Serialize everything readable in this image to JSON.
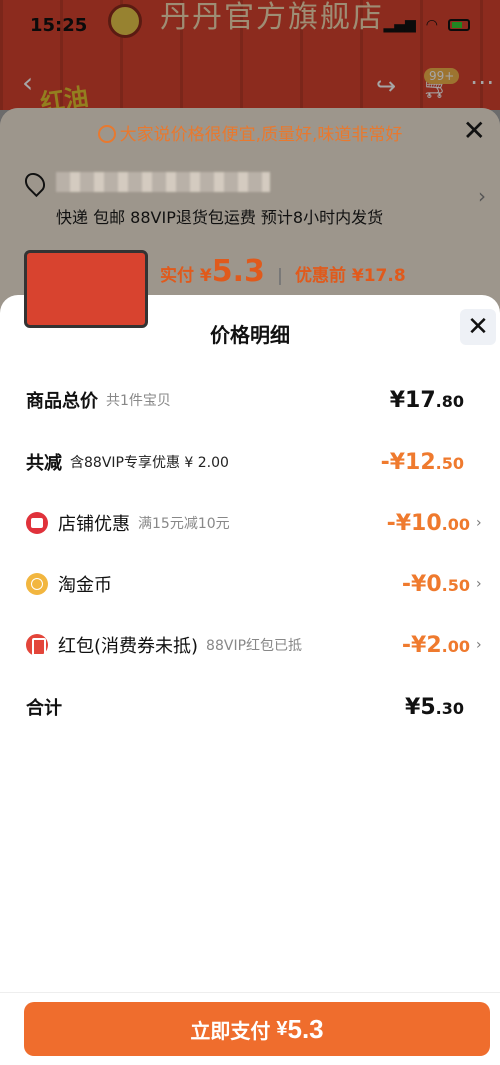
{
  "status_bar": {
    "time": "15:25"
  },
  "store": {
    "title": "丹丹官方旗舰店",
    "cart_badge": "99+"
  },
  "background": {
    "banner_text": "红油",
    "hint": "大家说价格很便宜,质量好,味道非常好",
    "shipping": "快递 包邮 88VIP退货包运费 预计8小时内发货",
    "price_prefix": "实付 ¥",
    "price_value": "5.3",
    "price_before": "优惠前 ¥17.8"
  },
  "sheet": {
    "title": "价格明细",
    "rows": [
      {
        "label": "商品总价",
        "sub": "共1件宝贝",
        "amount_int": "¥17",
        "amount_dec": ".80"
      },
      {
        "label": "共减",
        "sub": "含88VIP专享优惠 ¥ 2.00",
        "amount_int": "-¥12",
        "amount_dec": ".50"
      },
      {
        "label": "店铺优惠",
        "sub": "满15元减10元",
        "amount_int": "-¥10",
        "amount_dec": ".00"
      },
      {
        "label": "淘金币",
        "sub": "",
        "amount_int": "-¥0",
        "amount_dec": ".50"
      },
      {
        "label": "红包(消费券未抵)",
        "sub": "88VIP红包已抵",
        "amount_int": "-¥2",
        "amount_dec": ".00"
      },
      {
        "label": "合计",
        "sub": "",
        "amount_int": "¥5",
        "amount_dec": ".30"
      }
    ]
  },
  "pay": {
    "label": "立即支付",
    "yen": "¥",
    "amount": "5.3"
  },
  "colors": {
    "accent": "#ef6d2d",
    "discount": "#ef7a2e"
  },
  "icons": [
    "back-icon",
    "share-icon",
    "cart-icon",
    "more-icon",
    "close-icon",
    "location-icon",
    "shop-icon",
    "coin-icon",
    "red-packet-icon",
    "chevron-right-icon"
  ]
}
